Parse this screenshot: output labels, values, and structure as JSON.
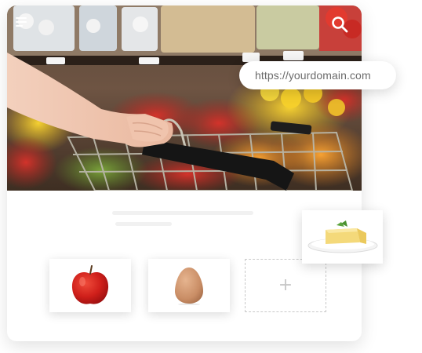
{
  "header": {
    "menu_icon": "menu-icon",
    "search_icon": "search-icon"
  },
  "hero": {
    "image": "shopping-cart-in-produce-aisle"
  },
  "address_bar": {
    "url": "https://yourdomain.com"
  },
  "products": [
    {
      "name_icon": "apple-icon"
    },
    {
      "name_icon": "egg-icon"
    }
  ],
  "add_tile": {
    "symbol": "+"
  },
  "floating_product": {
    "name_icon": "butter-icon"
  },
  "colors": {
    "card_bg": "#ffffff",
    "placeholder_line": "#f1f1f1",
    "dashed_border": "#c9c9c9",
    "url_text": "#6b6b6b"
  }
}
